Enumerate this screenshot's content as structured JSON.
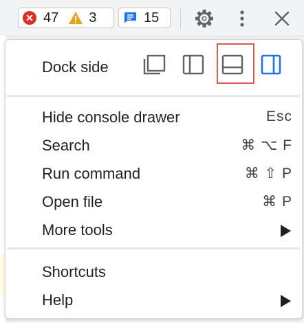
{
  "toolbar": {
    "errors_count": "47",
    "warnings_count": "3",
    "messages_count": "15",
    "icons": [
      "error-icon",
      "warning-icon",
      "message-icon",
      "settings-gear-icon",
      "more-vertical-icon",
      "close-icon"
    ]
  },
  "menu": {
    "dock_side_label": "Dock side",
    "dock_options": [
      "undock-into-separate-window-icon",
      "dock-to-left-icon",
      "dock-to-bottom-icon",
      "dock-to-right-icon"
    ],
    "selected_dock": "dock-to-right-icon",
    "highlighted_dock": "dock-to-bottom-icon",
    "items": [
      {
        "label": "Hide console drawer",
        "shortcut": "Esc"
      },
      {
        "label": "Search",
        "shortcut": "⌘ ⌥ F"
      },
      {
        "label": "Run command",
        "shortcut": "⌘ ⇧ P"
      },
      {
        "label": "Open file",
        "shortcut": "⌘ P"
      },
      {
        "label": "More tools",
        "shortcut": ""
      }
    ],
    "items2": [
      {
        "label": "Shortcuts",
        "shortcut": ""
      },
      {
        "label": "Help",
        "shortcut": ""
      }
    ]
  },
  "colors": {
    "accent_blue": "#1a73e8",
    "error_red": "#d93025",
    "warning_orange": "#e8a317",
    "highlight_red": "#e05a50",
    "icon_gray": "#5f6368"
  }
}
